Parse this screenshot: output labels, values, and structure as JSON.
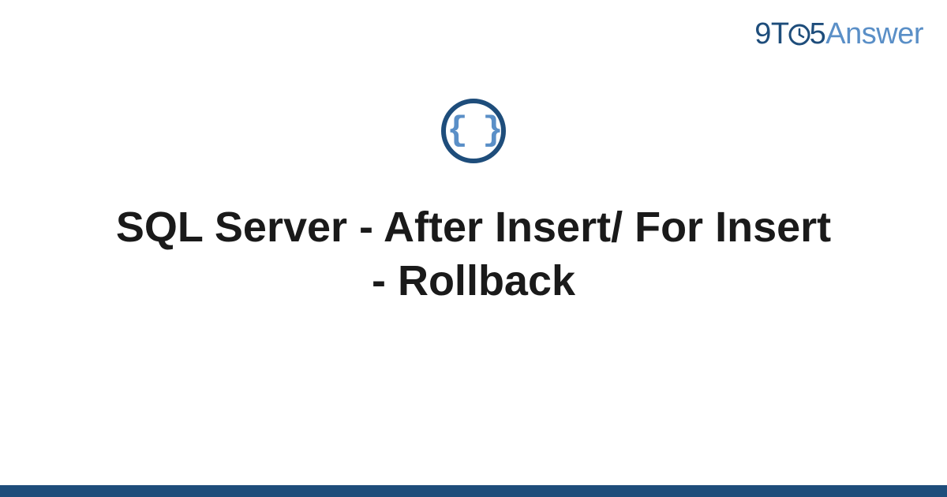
{
  "logo": {
    "part1": "9T",
    "part2": "5",
    "part3": "Answer"
  },
  "icon": {
    "name": "code-braces",
    "glyph": "{ }"
  },
  "title": "SQL Server - After Insert/ For Insert - Rollback",
  "colors": {
    "primary": "#1e4d7b",
    "secondary": "#5a8fc7",
    "text": "#1a1a1a"
  }
}
